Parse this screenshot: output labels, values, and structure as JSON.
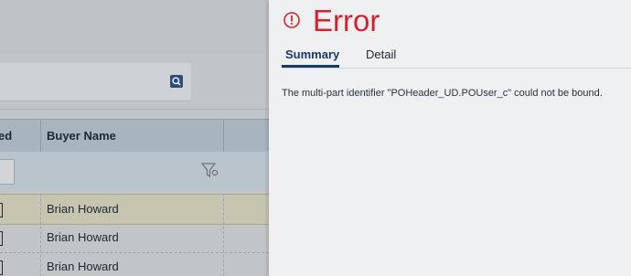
{
  "error_panel": {
    "title": "Error",
    "tabs": [
      {
        "label": "Summary",
        "active": true
      },
      {
        "label": "Detail",
        "active": false
      }
    ],
    "message": "The multi-part identifier \"POHeader_UD.POUser_c\" could not be bound.",
    "accent_color": "#d8222a"
  },
  "background_grid": {
    "columns": [
      {
        "header": "ed"
      },
      {
        "header": "Buyer Name"
      }
    ],
    "rows": [
      {
        "buyer_name": "Brian Howard",
        "selected": true
      },
      {
        "buyer_name": "Brian Howard",
        "selected": false
      },
      {
        "buyer_name": "Brian Howard",
        "selected": false
      }
    ]
  },
  "icons": {
    "error": "exclamation-circle-icon",
    "search": "search-icon",
    "filter": "filter-funnel-icon"
  }
}
